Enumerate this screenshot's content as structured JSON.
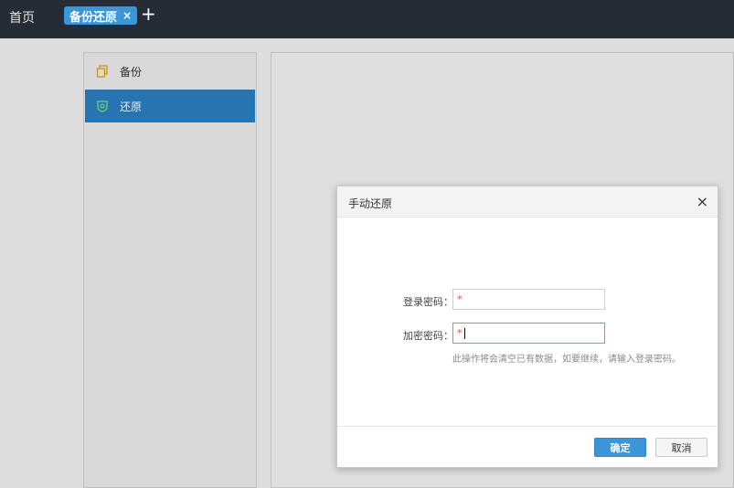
{
  "topbar": {
    "home_label": "首页",
    "active_tab_label": "备份还原",
    "tab_close": "×",
    "add_tab": "+"
  },
  "sidebar": {
    "items": [
      {
        "label": "备份",
        "icon": "copy-icon",
        "active": false
      },
      {
        "label": "还原",
        "icon": "shield-icon",
        "active": true
      }
    ]
  },
  "dialog": {
    "title": "手动还原",
    "close": "×",
    "fields": [
      {
        "label": "登录密码：",
        "required_mark": "*",
        "value": "",
        "focused": false
      },
      {
        "label": "加密密码：",
        "required_mark": "*",
        "value": "",
        "focused": true
      }
    ],
    "hint": "此操作将会清空已有数据，如要继续，请输入登录密码。",
    "ok_label": "确定",
    "cancel_label": "取消"
  },
  "colors": {
    "topbar": "#262c35",
    "accent": "#3a96d8",
    "sidebar_active": "#2a7fc2",
    "required": "#d9534f"
  }
}
